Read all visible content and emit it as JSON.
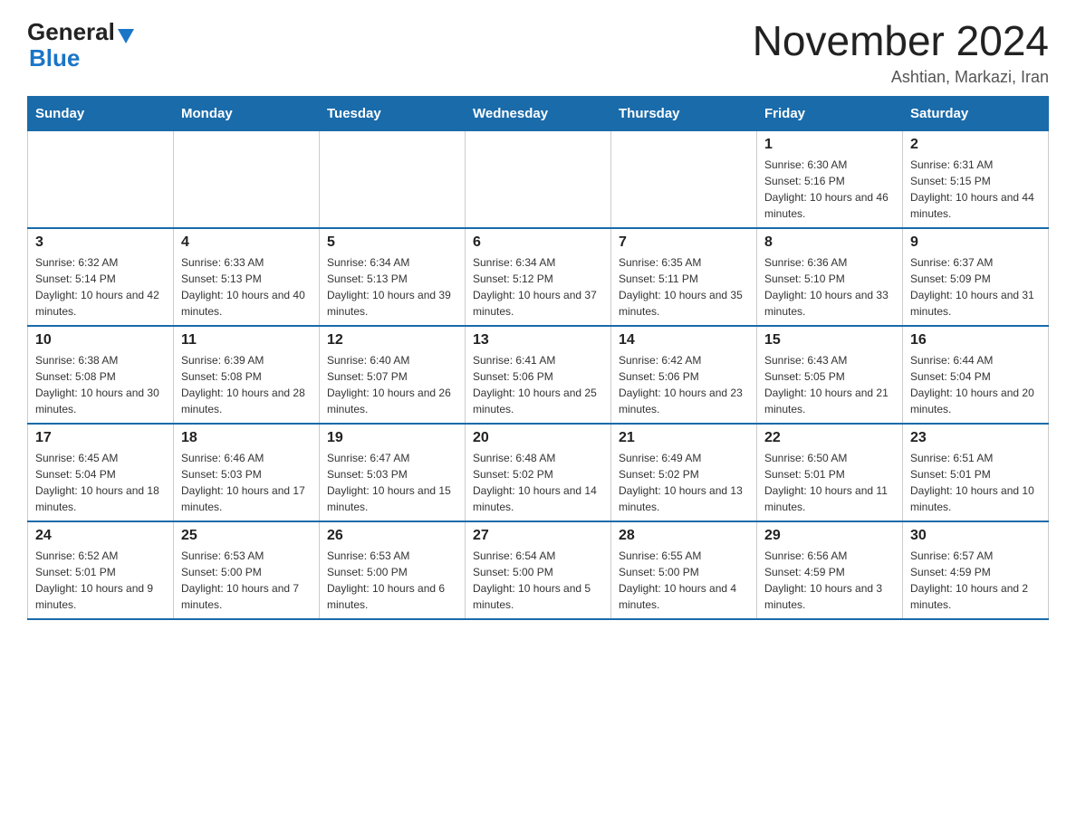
{
  "header": {
    "logo_general": "General",
    "logo_blue": "Blue",
    "month_title": "November 2024",
    "subtitle": "Ashtian, Markazi, Iran"
  },
  "weekdays": [
    "Sunday",
    "Monday",
    "Tuesday",
    "Wednesday",
    "Thursday",
    "Friday",
    "Saturday"
  ],
  "weeks": [
    [
      {
        "day": "",
        "info": ""
      },
      {
        "day": "",
        "info": ""
      },
      {
        "day": "",
        "info": ""
      },
      {
        "day": "",
        "info": ""
      },
      {
        "day": "",
        "info": ""
      },
      {
        "day": "1",
        "info": "Sunrise: 6:30 AM\nSunset: 5:16 PM\nDaylight: 10 hours and 46 minutes."
      },
      {
        "day": "2",
        "info": "Sunrise: 6:31 AM\nSunset: 5:15 PM\nDaylight: 10 hours and 44 minutes."
      }
    ],
    [
      {
        "day": "3",
        "info": "Sunrise: 6:32 AM\nSunset: 5:14 PM\nDaylight: 10 hours and 42 minutes."
      },
      {
        "day": "4",
        "info": "Sunrise: 6:33 AM\nSunset: 5:13 PM\nDaylight: 10 hours and 40 minutes."
      },
      {
        "day": "5",
        "info": "Sunrise: 6:34 AM\nSunset: 5:13 PM\nDaylight: 10 hours and 39 minutes."
      },
      {
        "day": "6",
        "info": "Sunrise: 6:34 AM\nSunset: 5:12 PM\nDaylight: 10 hours and 37 minutes."
      },
      {
        "day": "7",
        "info": "Sunrise: 6:35 AM\nSunset: 5:11 PM\nDaylight: 10 hours and 35 minutes."
      },
      {
        "day": "8",
        "info": "Sunrise: 6:36 AM\nSunset: 5:10 PM\nDaylight: 10 hours and 33 minutes."
      },
      {
        "day": "9",
        "info": "Sunrise: 6:37 AM\nSunset: 5:09 PM\nDaylight: 10 hours and 31 minutes."
      }
    ],
    [
      {
        "day": "10",
        "info": "Sunrise: 6:38 AM\nSunset: 5:08 PM\nDaylight: 10 hours and 30 minutes."
      },
      {
        "day": "11",
        "info": "Sunrise: 6:39 AM\nSunset: 5:08 PM\nDaylight: 10 hours and 28 minutes."
      },
      {
        "day": "12",
        "info": "Sunrise: 6:40 AM\nSunset: 5:07 PM\nDaylight: 10 hours and 26 minutes."
      },
      {
        "day": "13",
        "info": "Sunrise: 6:41 AM\nSunset: 5:06 PM\nDaylight: 10 hours and 25 minutes."
      },
      {
        "day": "14",
        "info": "Sunrise: 6:42 AM\nSunset: 5:06 PM\nDaylight: 10 hours and 23 minutes."
      },
      {
        "day": "15",
        "info": "Sunrise: 6:43 AM\nSunset: 5:05 PM\nDaylight: 10 hours and 21 minutes."
      },
      {
        "day": "16",
        "info": "Sunrise: 6:44 AM\nSunset: 5:04 PM\nDaylight: 10 hours and 20 minutes."
      }
    ],
    [
      {
        "day": "17",
        "info": "Sunrise: 6:45 AM\nSunset: 5:04 PM\nDaylight: 10 hours and 18 minutes."
      },
      {
        "day": "18",
        "info": "Sunrise: 6:46 AM\nSunset: 5:03 PM\nDaylight: 10 hours and 17 minutes."
      },
      {
        "day": "19",
        "info": "Sunrise: 6:47 AM\nSunset: 5:03 PM\nDaylight: 10 hours and 15 minutes."
      },
      {
        "day": "20",
        "info": "Sunrise: 6:48 AM\nSunset: 5:02 PM\nDaylight: 10 hours and 14 minutes."
      },
      {
        "day": "21",
        "info": "Sunrise: 6:49 AM\nSunset: 5:02 PM\nDaylight: 10 hours and 13 minutes."
      },
      {
        "day": "22",
        "info": "Sunrise: 6:50 AM\nSunset: 5:01 PM\nDaylight: 10 hours and 11 minutes."
      },
      {
        "day": "23",
        "info": "Sunrise: 6:51 AM\nSunset: 5:01 PM\nDaylight: 10 hours and 10 minutes."
      }
    ],
    [
      {
        "day": "24",
        "info": "Sunrise: 6:52 AM\nSunset: 5:01 PM\nDaylight: 10 hours and 9 minutes."
      },
      {
        "day": "25",
        "info": "Sunrise: 6:53 AM\nSunset: 5:00 PM\nDaylight: 10 hours and 7 minutes."
      },
      {
        "day": "26",
        "info": "Sunrise: 6:53 AM\nSunset: 5:00 PM\nDaylight: 10 hours and 6 minutes."
      },
      {
        "day": "27",
        "info": "Sunrise: 6:54 AM\nSunset: 5:00 PM\nDaylight: 10 hours and 5 minutes."
      },
      {
        "day": "28",
        "info": "Sunrise: 6:55 AM\nSunset: 5:00 PM\nDaylight: 10 hours and 4 minutes."
      },
      {
        "day": "29",
        "info": "Sunrise: 6:56 AM\nSunset: 4:59 PM\nDaylight: 10 hours and 3 minutes."
      },
      {
        "day": "30",
        "info": "Sunrise: 6:57 AM\nSunset: 4:59 PM\nDaylight: 10 hours and 2 minutes."
      }
    ]
  ]
}
